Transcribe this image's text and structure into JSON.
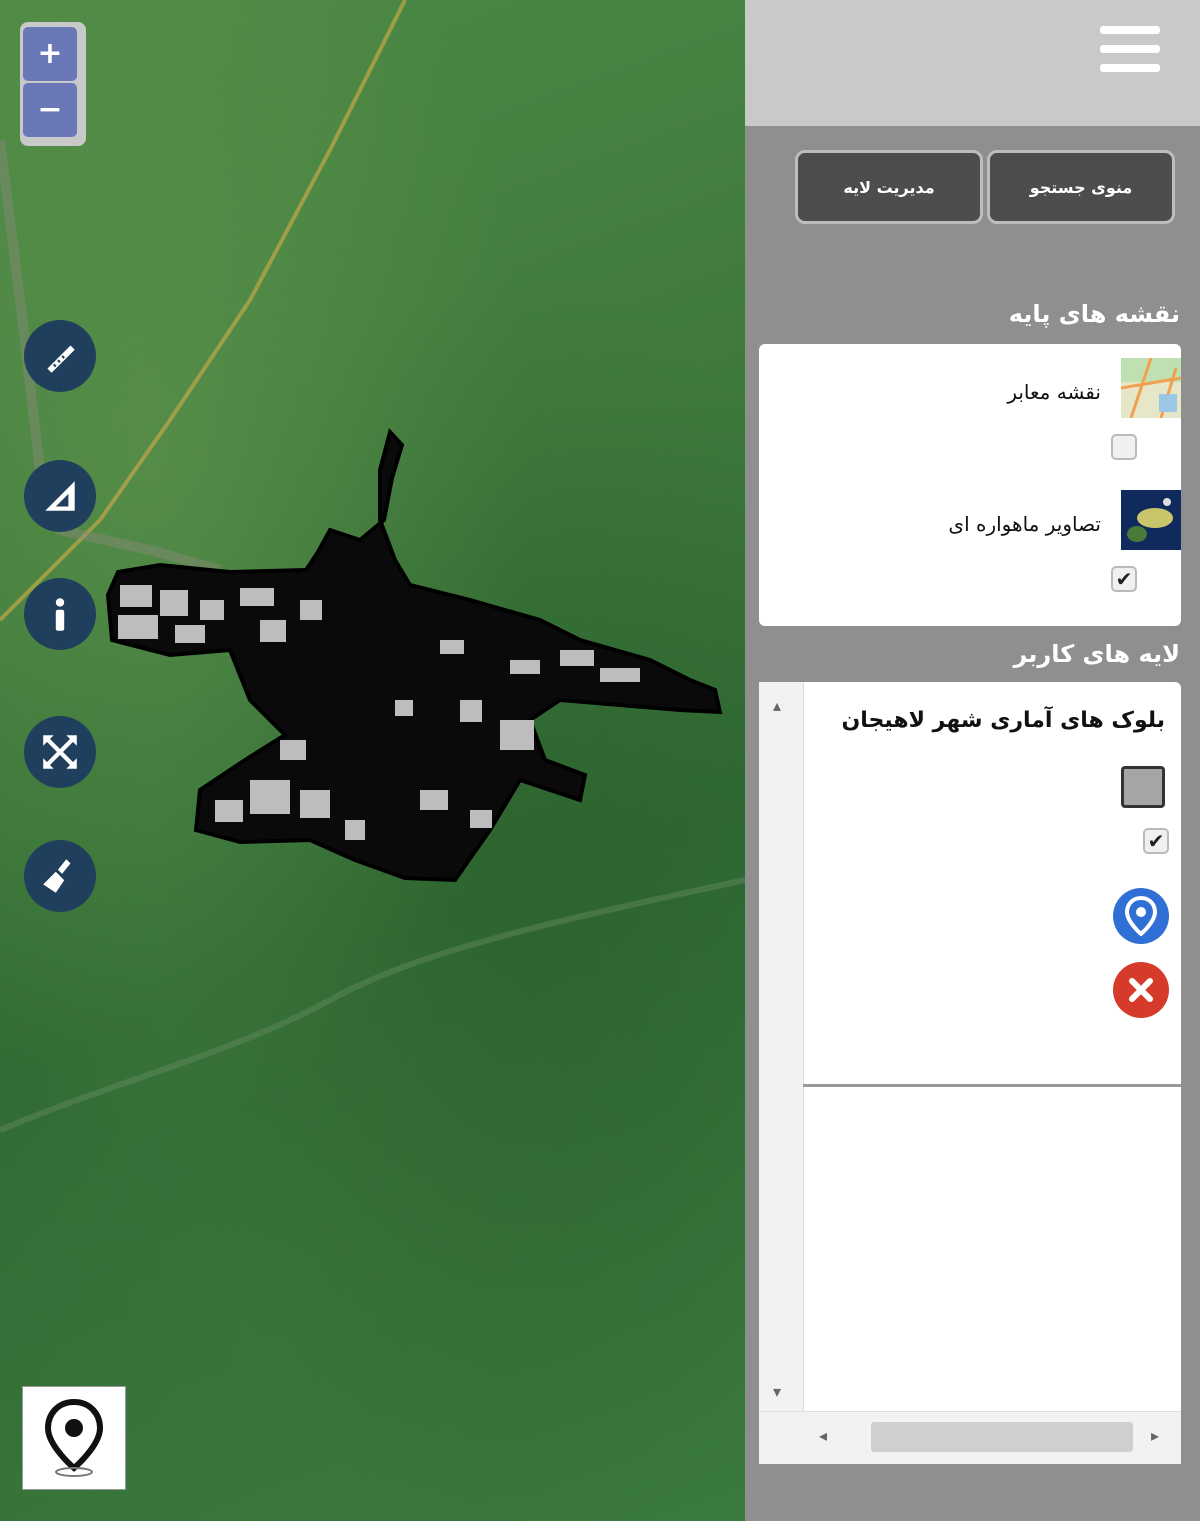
{
  "map": {
    "zoom_in_label": "+",
    "zoom_out_label": "−",
    "tools": [
      "measure-line-icon",
      "measure-area-icon",
      "info-icon",
      "full-extent-icon",
      "clear-icon"
    ],
    "locate_icon": "map-pin-icon"
  },
  "panel": {
    "menu_icon": "hamburger-menu-icon",
    "tabs": [
      {
        "label": "منوی جستجو"
      },
      {
        "label": "مدیریت لایه"
      }
    ],
    "base_maps_title": "نقشه های پایه",
    "base_maps": [
      {
        "label": "نقشه معابر",
        "checked": false
      },
      {
        "label": "تصاویر ماهواره ای",
        "checked": true
      }
    ],
    "user_layers_title": "لایه های کاربر",
    "user_layers": [
      {
        "label": "بلوک های آماری شهر لاهیجان",
        "checked": true
      }
    ]
  },
  "colors": {
    "zoom_button": "#6b78b8",
    "tool_button": "#1f3f5c",
    "locate_button": "#2f6fd6",
    "remove_button": "#d63a2a",
    "panel_bg": "#8f8f8f",
    "tab_bg": "#4d4d4d"
  }
}
